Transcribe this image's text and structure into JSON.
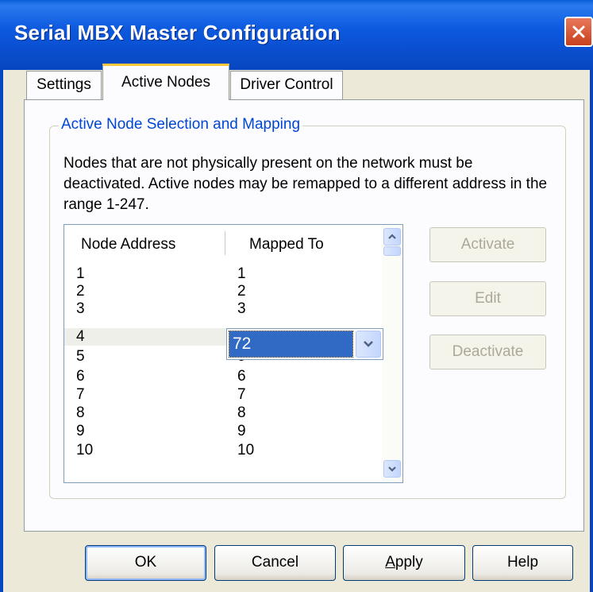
{
  "window": {
    "title": "Serial MBX Master Configuration"
  },
  "tabs": [
    {
      "label": "Settings"
    },
    {
      "label": "Active Nodes"
    },
    {
      "label": "Driver Control"
    }
  ],
  "group": {
    "title": "Active Node Selection and Mapping",
    "description": "Nodes that are not physically present on the network must be deactivated. Active nodes may be remapped to a different address in the range 1-247."
  },
  "list": {
    "columns": [
      "Node Address",
      "Mapped To"
    ],
    "rows": [
      {
        "address": "1",
        "mapped": "1"
      },
      {
        "address": "2",
        "mapped": "2"
      },
      {
        "address": "3",
        "mapped": "3"
      },
      {
        "address": "4",
        "mapped": ""
      },
      {
        "address": "5",
        "mapped": "5"
      },
      {
        "address": "6",
        "mapped": "6"
      },
      {
        "address": "7",
        "mapped": "7"
      },
      {
        "address": "8",
        "mapped": "8"
      },
      {
        "address": "9",
        "mapped": "9"
      },
      {
        "address": "10",
        "mapped": "10"
      }
    ],
    "selected_row": "4",
    "editor_value": "72"
  },
  "side_buttons": {
    "activate": "Activate",
    "edit": "Edit",
    "deactivate": "Deactivate"
  },
  "buttons": {
    "ok": "OK",
    "cancel": "Cancel",
    "apply_mnemonic": "A",
    "apply_rest": "pply",
    "help": "Help"
  },
  "colors": {
    "title_bar": "#0a4fd0",
    "group_title": "#0046d5",
    "selection": "#316ac5",
    "disabled_text": "#aca899",
    "close_button": "#d2502a"
  },
  "icons": {
    "close": "close-icon",
    "scroll_up": "chevron-up-icon",
    "scroll_down": "chevron-down-icon",
    "combo_dropdown": "chevron-down-icon"
  }
}
